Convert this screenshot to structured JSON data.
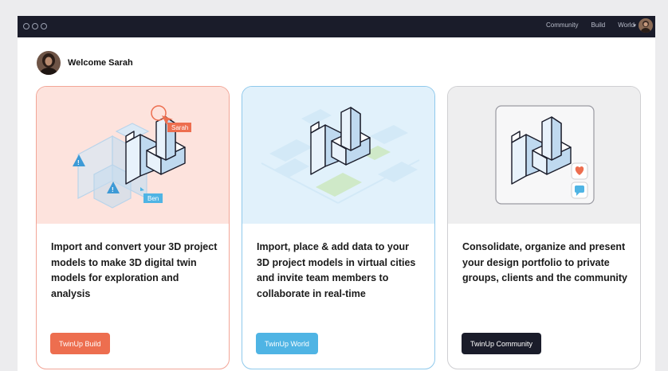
{
  "window": {
    "icons": {
      "controls": "window-controls"
    }
  },
  "nav": {
    "community": "Community",
    "build": "Build",
    "world": "World",
    "caret": "▾"
  },
  "welcome": {
    "text": "Welcome Sarah"
  },
  "cards": [
    {
      "description": "Import and convert your 3D project models to make 3D digital twin models for exploration and analysis",
      "button": "TwinUp Build",
      "labels": {
        "sarah": "Sarah",
        "ben": "Ben"
      },
      "accent": "#ed6e4f"
    },
    {
      "description": "Import, place & add data to your 3D project models in virtual cities and invite team members to collaborate in real-time",
      "button": "TwinUp World",
      "accent": "#4fb4e4"
    },
    {
      "description": "Consolidate, organize and present your design portfolio to private groups, clients and the community",
      "button": "TwinUp Community",
      "accent": "#1a1c2a"
    }
  ]
}
